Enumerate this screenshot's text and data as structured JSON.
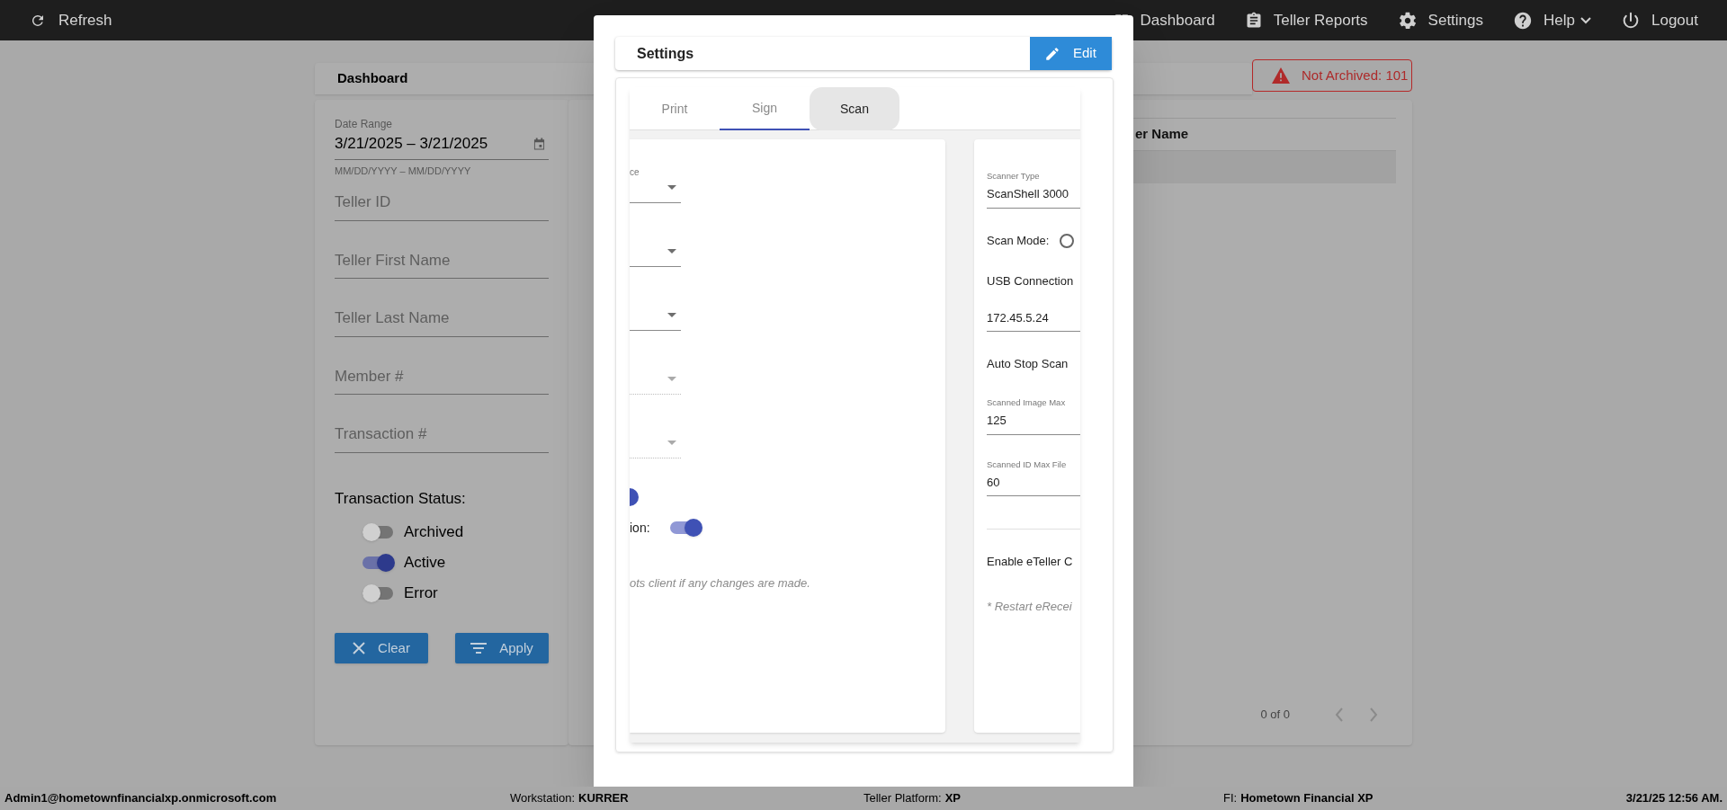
{
  "top_bar": {
    "refresh": "Refresh",
    "nav": [
      {
        "label": "Dashboard",
        "dropdown": false
      },
      {
        "label": "Teller Reports",
        "dropdown": false
      },
      {
        "label": "Settings",
        "dropdown": false
      },
      {
        "label": "Help",
        "dropdown": true
      },
      {
        "label": "Logout",
        "dropdown": false
      }
    ]
  },
  "dashboard": {
    "title": "Dashboard",
    "alert": "Not Archived: 101"
  },
  "filters": {
    "date_range": {
      "label": "Date Range",
      "value": "3/21/2025 – 3/21/2025",
      "hint": "MM/DD/YYYY – MM/DD/YYYY"
    },
    "fields": [
      {
        "placeholder": "Teller ID"
      },
      {
        "placeholder": "Teller First Name"
      },
      {
        "placeholder": "Teller Last Name"
      },
      {
        "placeholder": "Member #"
      },
      {
        "placeholder": "Transaction #"
      }
    ],
    "status_label": "Transaction Status:",
    "statuses": [
      {
        "label": "Archived",
        "on": false
      },
      {
        "label": "Active",
        "on": true
      },
      {
        "label": "Error",
        "on": false
      }
    ],
    "buttons": [
      {
        "label": "Clear",
        "kind": "clear"
      },
      {
        "label": "Apply",
        "kind": "apply"
      }
    ]
  },
  "table": {
    "columns": [
      "er Name"
    ],
    "pagination": "0 of 0"
  },
  "modal": {
    "title": "Settings",
    "edit": "Edit",
    "tabs": [
      {
        "label": "Print",
        "selected": false,
        "highlighted": false
      },
      {
        "label": "Sign",
        "selected": true,
        "highlighted": false
      },
      {
        "label": "Scan",
        "selected": false,
        "highlighted": true
      }
    ],
    "left_card": [
      {
        "kind": "dropdown",
        "label": "ce",
        "disabled": false
      },
      {
        "kind": "dropdown",
        "disabled": false
      },
      {
        "kind": "dropdown",
        "disabled": false
      },
      {
        "kind": "dropdown",
        "disabled": true
      },
      {
        "kind": "dropdown",
        "disabled": true
      },
      {
        "kind": "toggle",
        "on": true
      },
      {
        "kind": "toggle",
        "label": "ion:",
        "on": true
      },
      {
        "kind": "note",
        "text": "ots client if any changes are made."
      }
    ],
    "right_card": [
      {
        "kind": "field",
        "label": "Scanner Type",
        "value": "ScanShell 3000"
      },
      {
        "kind": "radio",
        "label": "Scan Mode:",
        "checked": false
      },
      {
        "kind": "text",
        "text": "USB Connection"
      },
      {
        "kind": "field",
        "value": "172.45.5.24"
      },
      {
        "kind": "text",
        "text": "Auto Stop Scan"
      },
      {
        "kind": "field",
        "label": "Scanned Image Max",
        "value": "125"
      },
      {
        "kind": "field",
        "label": "Scanned ID Max File",
        "value": "60"
      },
      {
        "kind": "divider"
      },
      {
        "kind": "text",
        "text": "Enable eTeller C"
      },
      {
        "kind": "note",
        "text": "* Restart eRecei"
      }
    ]
  },
  "status_bar": {
    "user": "Admin1@hometownfinancialxp.onmicrosoft.com",
    "items": [
      {
        "label": "Workstation:",
        "value": "KURRER"
      },
      {
        "label": "Teller Platform:",
        "value": "XP"
      },
      {
        "label": "FI:",
        "value": "Hometown Financial XP"
      }
    ],
    "time": "3/21/25 12:56 AM."
  }
}
